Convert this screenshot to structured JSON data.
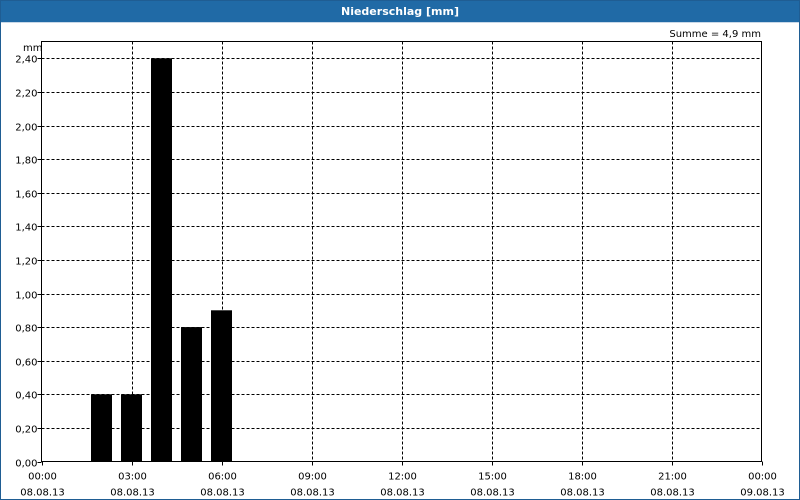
{
  "window": {
    "title": "Niederschlag [mm]",
    "title_bar_color": "#206aa6"
  },
  "chart_data": {
    "type": "bar",
    "title": "Niederschlag [mm]",
    "ylabel": "mm",
    "xlabel": "",
    "summary": "Summe = 4,9 mm",
    "ylim": [
      0,
      2.5
    ],
    "y_ticks": [
      "0,00",
      "0,20",
      "0,40",
      "0,60",
      "0,80",
      "1,00",
      "1,20",
      "1,40",
      "1,60",
      "1,80",
      "2,00",
      "2,20",
      "2,40"
    ],
    "x_ticks": [
      {
        "time": "00:00",
        "date": "08.08.13"
      },
      {
        "time": "03:00",
        "date": "08.08.13"
      },
      {
        "time": "06:00",
        "date": "08.08.13"
      },
      {
        "time": "09:00",
        "date": "08.08.13"
      },
      {
        "time": "12:00",
        "date": "08.08.13"
      },
      {
        "time": "15:00",
        "date": "08.08.13"
      },
      {
        "time": "18:00",
        "date": "08.08.13"
      },
      {
        "time": "21:00",
        "date": "08.08.13"
      },
      {
        "time": "00:00",
        "date": "09.08.13"
      }
    ],
    "x_range_hours": [
      0,
      24
    ],
    "bars": [
      {
        "hour": 2,
        "value": 0.4
      },
      {
        "hour": 3,
        "value": 0.4
      },
      {
        "hour": 4,
        "value": 2.4
      },
      {
        "hour": 5,
        "value": 0.8
      },
      {
        "hour": 6,
        "value": 0.9
      }
    ],
    "grid": true,
    "bar_color": "#000000"
  }
}
